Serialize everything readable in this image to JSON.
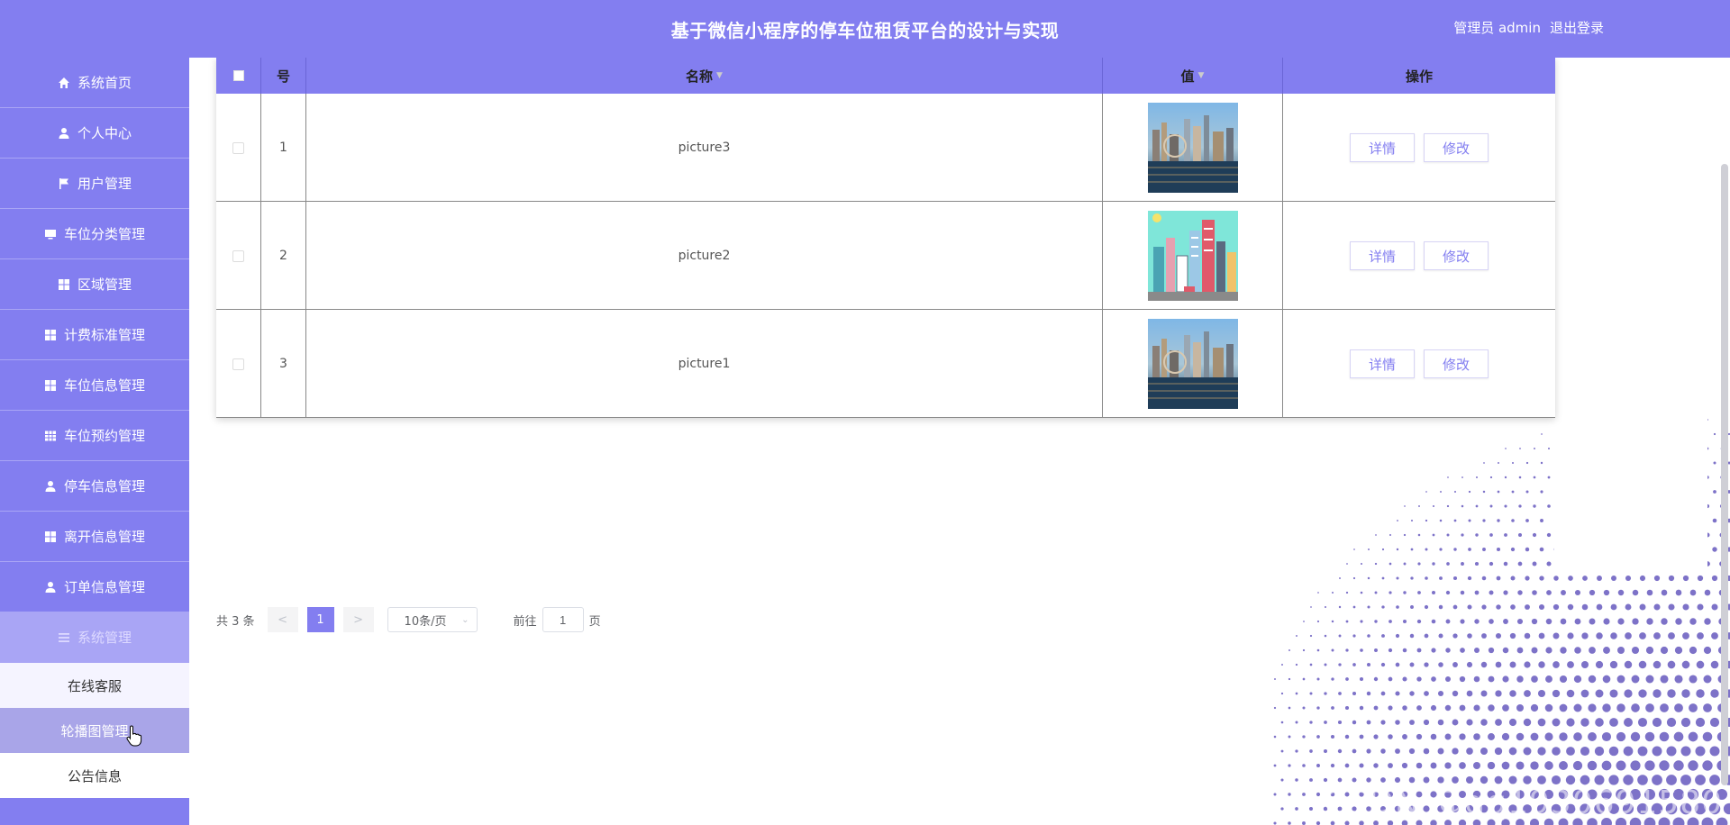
{
  "header": {
    "title": "基于微信小程序的停车位租赁平台的设计与实现",
    "user_label": "管理员 admin",
    "logout_label": "退出登录"
  },
  "sidebar": {
    "items": [
      {
        "label": "系统首页",
        "icon": "home-icon"
      },
      {
        "label": "个人中心",
        "icon": "user-icon"
      },
      {
        "label": "用户管理",
        "icon": "flag-icon"
      },
      {
        "label": "车位分类管理",
        "icon": "monitor-icon"
      },
      {
        "label": "区域管理",
        "icon": "grid-icon"
      },
      {
        "label": "计费标准管理",
        "icon": "grid-icon"
      },
      {
        "label": "车位信息管理",
        "icon": "grid-icon"
      },
      {
        "label": "车位预约管理",
        "icon": "table-icon"
      },
      {
        "label": "停车信息管理",
        "icon": "user-icon"
      },
      {
        "label": "离开信息管理",
        "icon": "grid-icon"
      },
      {
        "label": "订单信息管理",
        "icon": "user-icon"
      },
      {
        "label": "系统管理",
        "icon": "menu-icon"
      }
    ],
    "submenu": [
      {
        "label": "在线客服"
      },
      {
        "label": "轮播图管理"
      },
      {
        "label": "公告信息"
      }
    ]
  },
  "table": {
    "columns": [
      "号",
      "名称",
      "值",
      "操作"
    ],
    "rows": [
      {
        "index": "1",
        "name": "picture3",
        "image": "city-skyline-photo"
      },
      {
        "index": "2",
        "name": "picture2",
        "image": "cartoon-city-illustration"
      },
      {
        "index": "3",
        "name": "picture1",
        "image": "city-skyline-photo"
      }
    ],
    "detail_label": "详情",
    "edit_label": "修改"
  },
  "pagination": {
    "total_label": "共 3 条",
    "prev": "<",
    "current_page": "1",
    "next": ">",
    "page_size": "10条/页",
    "goto_label": "前往",
    "goto_value": "1",
    "page_unit": "页"
  },
  "colors": {
    "primary": "#837ef0",
    "submenu_selected": "#a9a5e8"
  },
  "watermark": "CSDN @qq1930691580"
}
